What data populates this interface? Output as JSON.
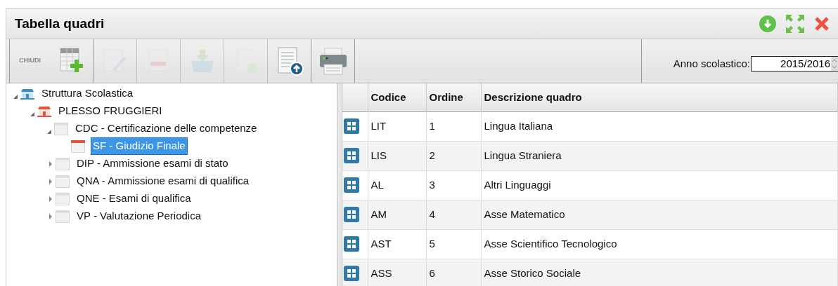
{
  "window": {
    "title": "Tabella quadri"
  },
  "toolbar": {
    "close_label": "CHIUDI",
    "buttons": [
      {
        "kind": "add",
        "disabled": false
      },
      {
        "kind": "edit",
        "disabled": true
      },
      {
        "kind": "delete",
        "disabled": true
      },
      {
        "kind": "basket",
        "disabled": true
      },
      {
        "kind": "download",
        "disabled": true
      },
      {
        "kind": "upload",
        "disabled": false
      },
      {
        "kind": "print",
        "disabled": false
      }
    ],
    "year": {
      "label": "Anno scolastico:",
      "value": "2015/2016"
    }
  },
  "tree": [
    {
      "label": "Struttura Scolastica",
      "kind": "school",
      "expanded": true,
      "selected": false,
      "children": [
        {
          "label": "PLESSO FRUGGIERI",
          "kind": "building",
          "expanded": true,
          "selected": false,
          "children": [
            {
              "label": "CDC - Certificazione delle competenze",
              "kind": "frame",
              "expanded": true,
              "selected": false,
              "children": [
                {
                  "label": "SF - Giudizio Finale",
                  "kind": "calendar",
                  "selected": true
                }
              ]
            },
            {
              "label": "DIP - Ammissione esami di stato",
              "kind": "frame",
              "expanded": false,
              "selected": false
            },
            {
              "label": "QNA - Ammissione esami di qualifica",
              "kind": "frame",
              "expanded": false,
              "selected": false
            },
            {
              "label": "QNE - Esami di qualifica",
              "kind": "frame",
              "expanded": false,
              "selected": false
            },
            {
              "label": "VP - Valutazione Periodica",
              "kind": "frame",
              "expanded": false,
              "selected": false
            }
          ]
        }
      ]
    }
  ],
  "table": {
    "columns": [
      "Codice",
      "Ordine",
      "Descrizione quadro"
    ],
    "rows": [
      [
        "LIT",
        "1",
        "Lingua Italiana"
      ],
      [
        "LIS",
        "2",
        "Lingua Straniera"
      ],
      [
        "AL",
        "3",
        "Altri Linguaggi"
      ],
      [
        "AM",
        "4",
        "Asse Matematico"
      ],
      [
        "AST",
        "5",
        "Asse Scientifico Tecnologico"
      ],
      [
        "ASS",
        "6",
        "Asse Storico Sociale"
      ]
    ]
  }
}
